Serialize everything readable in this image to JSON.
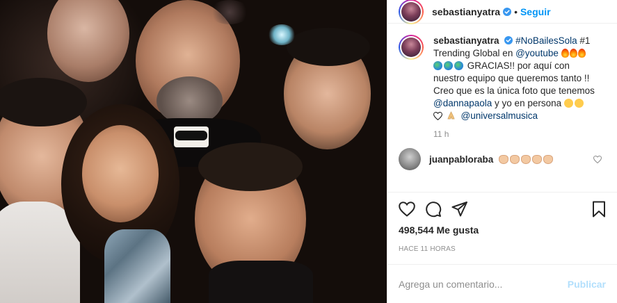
{
  "post": {
    "username": "sebastianyatra",
    "follow_label": "Seguir",
    "separator": "•"
  },
  "caption": {
    "username": "sebastianyatra",
    "hashtag": "#NoBailesSola",
    "rank": "#1",
    "line_trending": "Trending Global en",
    "mention_youtube": "@youtube",
    "gracias": "GRACIAS!! por aquí con nuestro equipo que queremos tanto !! Creo que es la única foto que tenemos",
    "mention_danna": "@dannapaola",
    "yo_en_persona": "y yo en persona",
    "mention_universal": "@universalmusica",
    "time": "11 h"
  },
  "comment": {
    "username": "juanpabloraba"
  },
  "likes": {
    "count_label": "498,544 Me gusta",
    "ago": "HACE 11 HORAS"
  },
  "add_comment": {
    "placeholder": "Agrega un comentario...",
    "publish_label": "Publicar"
  },
  "icons": [
    "heart-icon",
    "comment-icon",
    "share-icon",
    "bookmark-icon",
    "verified-icon"
  ],
  "colors": {
    "follow_blue": "#0095f6",
    "link_blue": "#00376b",
    "muted": "#8e8e8e",
    "publish_disabled": "#b2dffc"
  }
}
